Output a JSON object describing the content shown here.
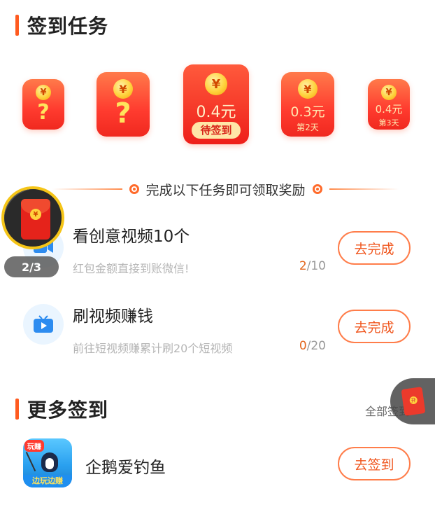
{
  "checkin": {
    "title": "签到任务",
    "packets": [
      {
        "coin": "¥",
        "mark": "?",
        "amount": "",
        "day": "",
        "button": ""
      },
      {
        "coin": "¥",
        "mark": "?",
        "amount": "",
        "day": "",
        "button": ""
      },
      {
        "coin": "¥",
        "mark": "",
        "amount": "0.4元",
        "day": "",
        "button": "待签到"
      },
      {
        "coin": "¥",
        "mark": "",
        "amount": "0.3元",
        "day": "第2天",
        "button": ""
      },
      {
        "coin": "¥",
        "mark": "",
        "amount": "0.4元",
        "day": "第3天",
        "button": ""
      }
    ],
    "divider_text": "完成以下任务即可领取奖励"
  },
  "tasks": [
    {
      "title": "看创意视频10个",
      "subtitle": "红包金额直接到账微信!",
      "progress_done": "2",
      "progress_total": "/10",
      "button": "去完成",
      "icon": "video-camera-icon"
    },
    {
      "title": "刷视频赚钱",
      "subtitle": "前往短视频赚累计刷20个短视频",
      "progress_done": "0",
      "progress_total": "/20",
      "button": "去完成",
      "icon": "tv-play-icon"
    }
  ],
  "floating_timer": {
    "count": "2/3",
    "coin": "¥"
  },
  "more": {
    "title": "更多签到",
    "all_label": "全部签到",
    "items": [
      {
        "name": "企鹅爱钓鱼",
        "badge": "玩赚",
        "footer": "边玩边赚",
        "button": "去签到"
      }
    ]
  },
  "side_float": {
    "label": "开"
  },
  "colors": {
    "accent": "#ff5a1f",
    "packet_red": "#ff3b2f",
    "coin_gold": "#ffd23d",
    "button_orange": "#f0561e"
  }
}
